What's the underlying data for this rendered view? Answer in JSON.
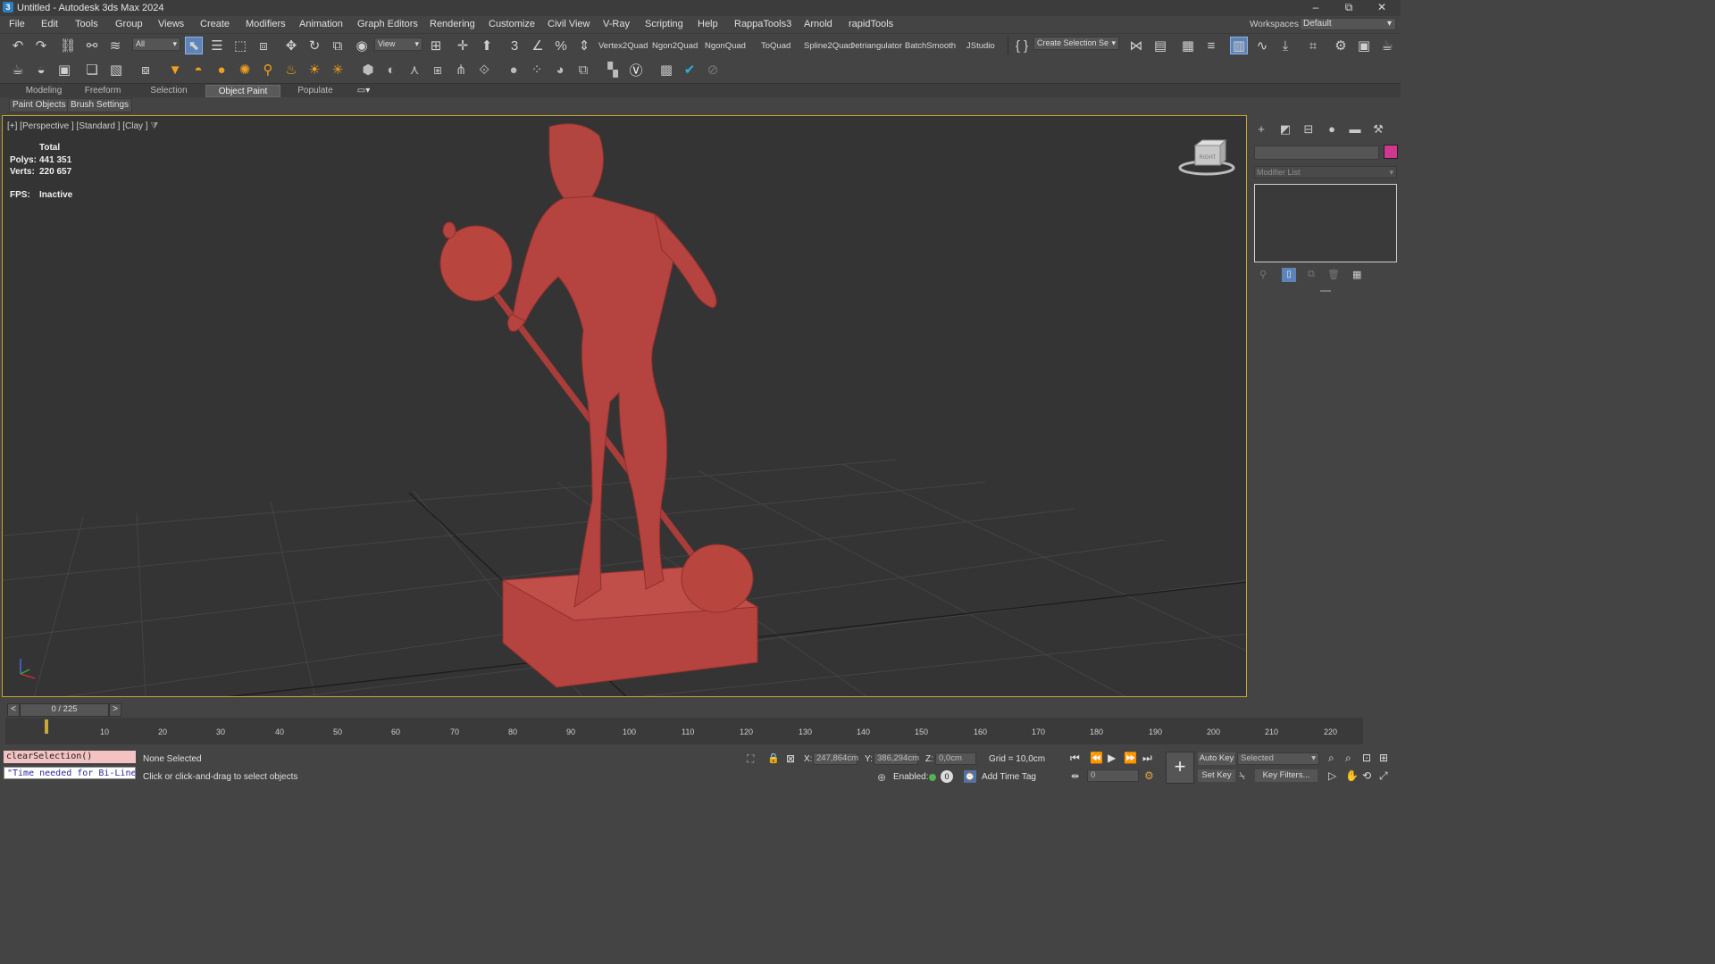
{
  "window": {
    "title": "Untitled - Autodesk 3ds Max 2024",
    "logo_text": "3",
    "controls": [
      "–",
      "⧉",
      "✕"
    ]
  },
  "menu": {
    "items": [
      "File",
      "Edit",
      "Tools",
      "Group",
      "Views",
      "Create",
      "Modifiers",
      "Animation",
      "Graph Editors",
      "Rendering",
      "Customize",
      "Civil View",
      "V-Ray",
      "Scripting",
      "Help",
      "RappaTools3",
      "Arnold",
      "rapidTools"
    ],
    "workspace_label": "Workspaces:",
    "workspace_value": "Default"
  },
  "toolbar": {
    "selection_filter": "All",
    "ref_coord": "View",
    "plugins": [
      "Vertex2Quad",
      "Ngon2Quad",
      "NgonQuad",
      "ToQuad",
      "Spline2Quad",
      "Detriangulator",
      "BatchSmooth",
      "JStudio"
    ],
    "named_selection": "Create Selection Se"
  },
  "ribbon": {
    "tabs": [
      "Modeling",
      "Freeform",
      "Selection",
      "Object Paint",
      "Populate"
    ],
    "active_tab": "Object Paint",
    "sub_buttons": [
      "Paint Objects",
      "Brush Settings"
    ]
  },
  "viewport": {
    "label": "[+] [Perspective ] [Standard ] [Clay ]",
    "stats": {
      "total_label": "Total",
      "polys_label": "Polys:",
      "polys_value": "441 351",
      "verts_label": "Verts:",
      "verts_value": "220 657",
      "fps_label": "FPS:",
      "fps_value": "Inactive"
    },
    "viewcube_label": "RIGHT",
    "model_color": "#b5433f",
    "border_color": "#c7a630"
  },
  "command_panel": {
    "modifier_list": "Modifier List",
    "swatch_color": "#d0388f"
  },
  "timeline": {
    "frame_display": "0 / 225",
    "prev": "<",
    "next": ">",
    "ticks": [
      "10",
      "20",
      "30",
      "40",
      "50",
      "60",
      "70",
      "80",
      "90",
      "100",
      "110",
      "120",
      "130",
      "140",
      "150",
      "160",
      "170",
      "180",
      "190",
      "200",
      "210",
      "220"
    ]
  },
  "status": {
    "maxscript_line1": "clearSelection()",
    "maxscript_line2": "\"Time needed for Bi-Line:",
    "selection_status": "None Selected",
    "prompt": "Click or click-and-drag to select objects",
    "x_label": "X:",
    "x_value": "247,864cm",
    "y_label": "Y:",
    "y_value": "386,294cm",
    "z_label": "Z:",
    "z_value": "0,0cm",
    "grid": "Grid = 10,0cm",
    "enabled_label": "Enabled:",
    "enabled_value": "0",
    "add_time_tag": "Add Time Tag",
    "auto_key": "Auto Key",
    "set_key": "Set Key",
    "key_mode": "Selected",
    "key_filters": "Key Filters...",
    "current_frame": "0"
  }
}
